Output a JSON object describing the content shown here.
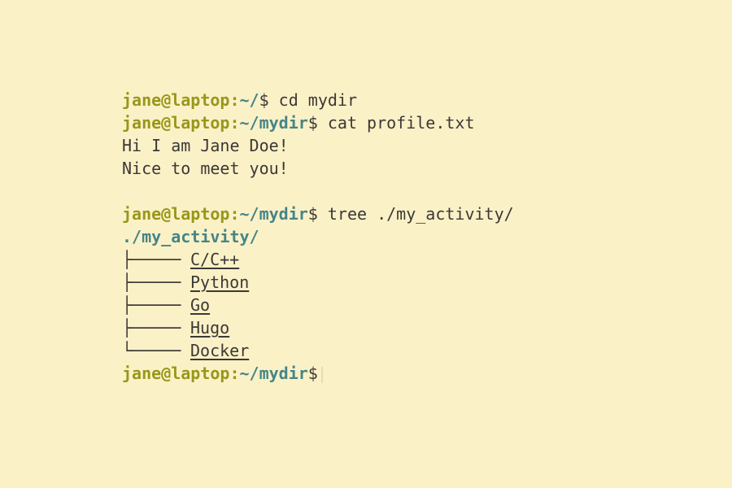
{
  "prompt": {
    "user_host": "jane@laptop",
    "colon": ":",
    "dollar": "$"
  },
  "lines": [
    {
      "path": "~/",
      "command": " cd mydir"
    },
    {
      "path": "~/mydir",
      "command": " cat profile.txt"
    },
    {
      "path": "~/mydir",
      "command": " tree ./my_activity/"
    }
  ],
  "output": {
    "profile": [
      "Hi I am Jane Doe!",
      "Nice to meet you!"
    ],
    "tree_root": "./my_activity/",
    "tree_items": [
      {
        "branch": "├─────",
        "name": "C/C++"
      },
      {
        "branch": "├─────",
        "name": "Python"
      },
      {
        "branch": "├─────",
        "name": "Go"
      },
      {
        "branch": "├─────",
        "name": "Hugo"
      },
      {
        "branch": "└─────",
        "name": "Docker"
      }
    ]
  },
  "final_prompt": {
    "path": "~/mydir"
  },
  "colors": {
    "background": "#fbf1c7",
    "user": "#98971a",
    "path": "#458588",
    "text": "#3c3836"
  }
}
